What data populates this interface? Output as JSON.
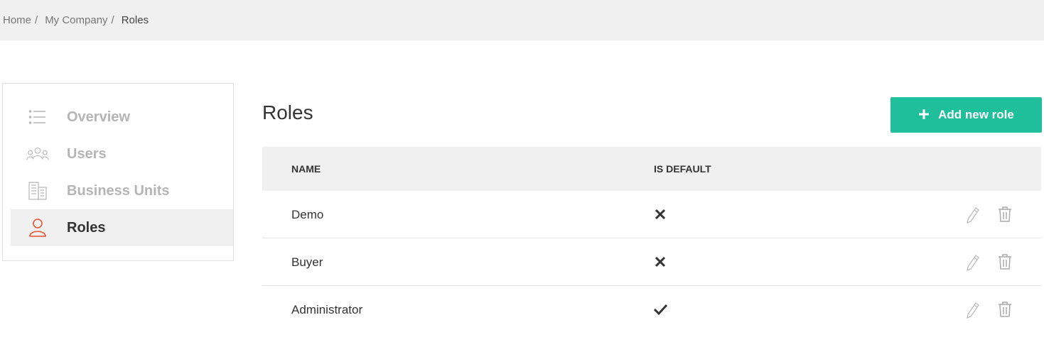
{
  "breadcrumb": {
    "items": [
      "Home",
      "My Company"
    ],
    "separator": "/",
    "current": "Roles"
  },
  "sidebar": {
    "items": [
      {
        "label": "Overview",
        "icon": "list-icon",
        "active": false
      },
      {
        "label": "Users",
        "icon": "users-icon",
        "active": false
      },
      {
        "label": "Business Units",
        "icon": "building-icon",
        "active": false
      },
      {
        "label": "Roles",
        "icon": "user-icon",
        "active": true
      }
    ]
  },
  "page": {
    "title": "Roles",
    "add_button_label": "Add new role",
    "add_button_icon": "plus-icon"
  },
  "table": {
    "columns": [
      "NAME",
      "IS DEFAULT"
    ],
    "rows": [
      {
        "name": "Demo",
        "is_default": false
      },
      {
        "name": "Buyer",
        "is_default": false
      },
      {
        "name": "Administrator",
        "is_default": true
      }
    ]
  },
  "colors": {
    "accent": "#1fbf9b",
    "active_icon": "#e8502e",
    "header_bg": "#f0f0f0",
    "muted_text": "#b5b5b5"
  }
}
